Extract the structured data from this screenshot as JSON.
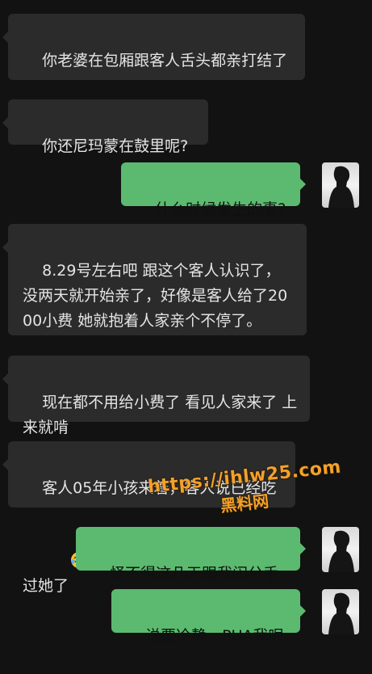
{
  "messages": [
    {
      "direction": "incoming",
      "text": "你老婆在包厢跟客人舌头都亲打结了"
    },
    {
      "direction": "incoming",
      "text": "你还尼玛蒙在鼓里呢?"
    },
    {
      "direction": "outgoing",
      "text": "什么时候发生的事?"
    },
    {
      "direction": "incoming",
      "text": "8.29号左右吧 跟这个客人认识了，没两天就开始亲了，好像是客人给了2000小费 她就抱着人家亲个不停了。"
    },
    {
      "direction": "incoming",
      "text": "现在都不用给小费了 看见人家来了 上来就啃"
    },
    {
      "direction": "incoming",
      "text": "客人05年小孩来着，客人说已经吃过她了",
      "emoji": "laughing-crying-emoji"
    },
    {
      "direction": "outgoing",
      "text": "怪不得这几天跟我闹分手"
    },
    {
      "direction": "outgoing",
      "text": "说要冷静，PUA我呢"
    }
  ],
  "watermark": {
    "url": "https://ihlw25.com",
    "site_name": "黑料网"
  },
  "colors": {
    "background": "#121212",
    "incoming_bubble": "#2b2b2b",
    "outgoing_bubble": "#5bba6f",
    "watermark": "#f3a12a"
  }
}
